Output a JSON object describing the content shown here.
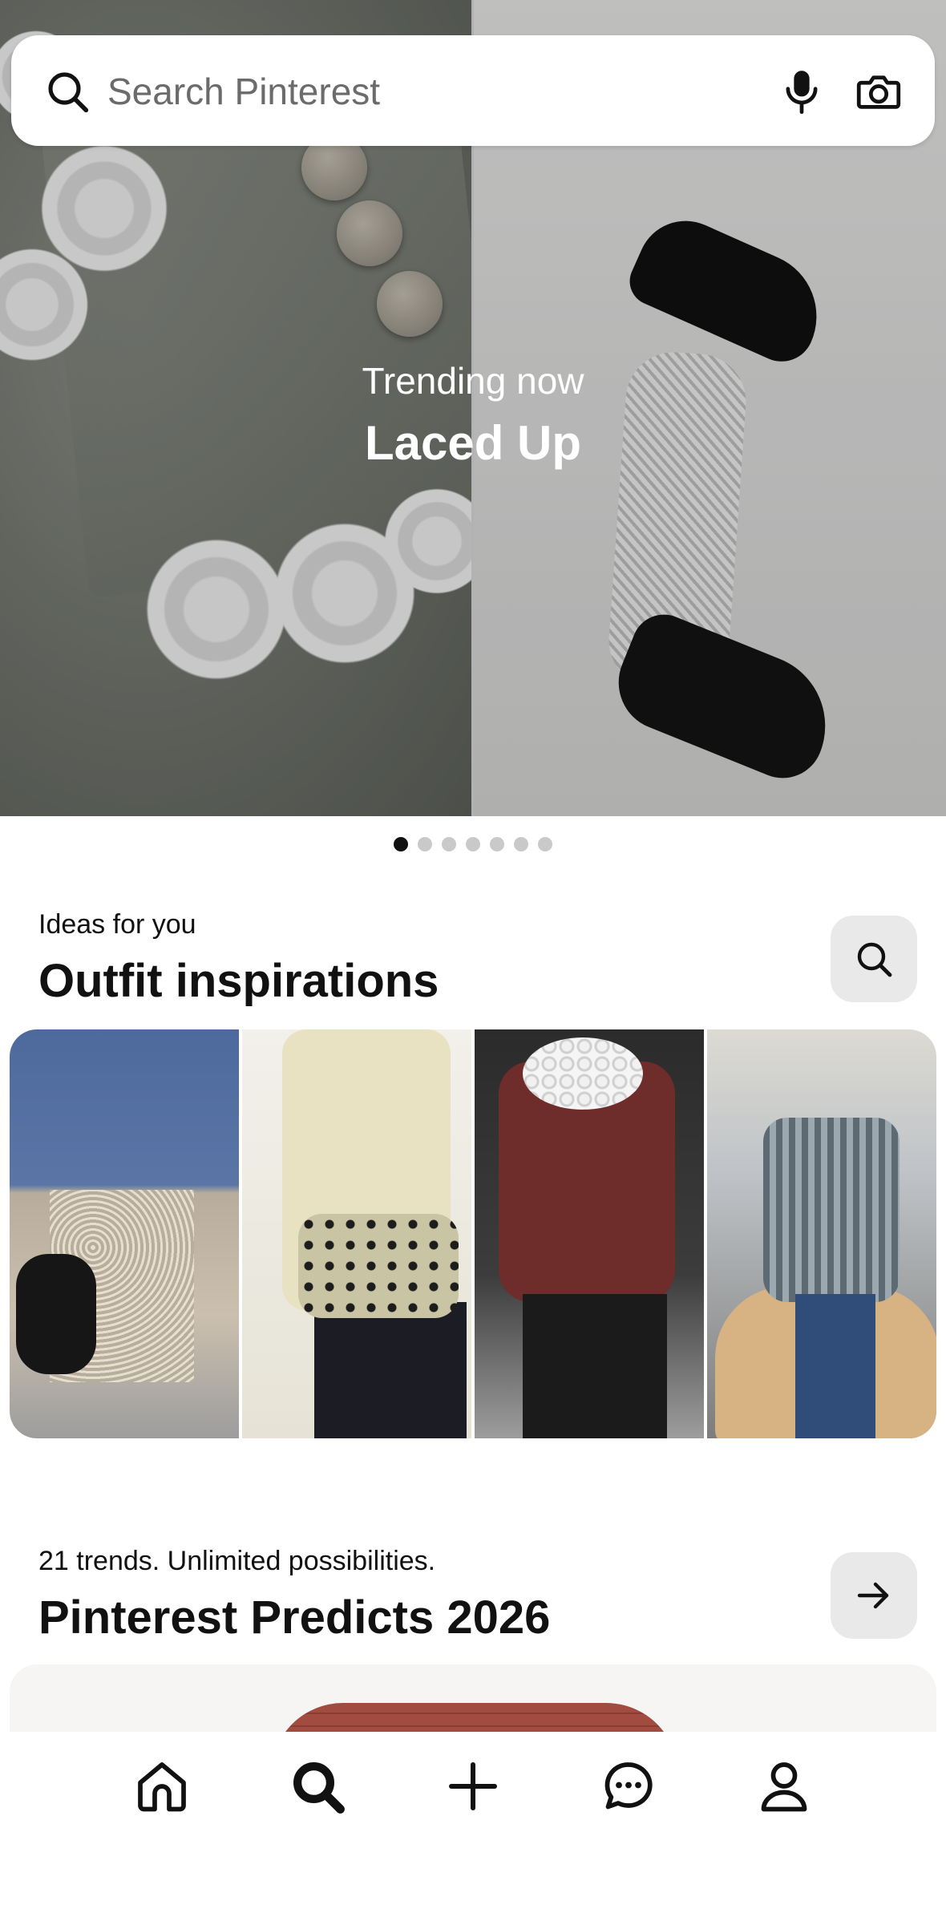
{
  "search": {
    "placeholder": "Search Pinterest"
  },
  "hero": {
    "subtitle": "Trending now",
    "title": "Laced Up",
    "carousel_total": 7,
    "carousel_active_index": 0
  },
  "ideas": {
    "subtitle": "Ideas for you",
    "title": "Outfit inspirations"
  },
  "predicts": {
    "subtitle": "21 trends. Unlimited possibilities.",
    "title": "Pinterest Predicts 2026"
  },
  "bottom_nav": {
    "items": [
      "home-icon",
      "search-icon",
      "create-icon",
      "messages-icon",
      "profile-icon"
    ],
    "active": "search-icon"
  },
  "colors": {
    "text": "#111111",
    "muted": "#6b6b6b",
    "button_bg": "#e9e9e9"
  }
}
